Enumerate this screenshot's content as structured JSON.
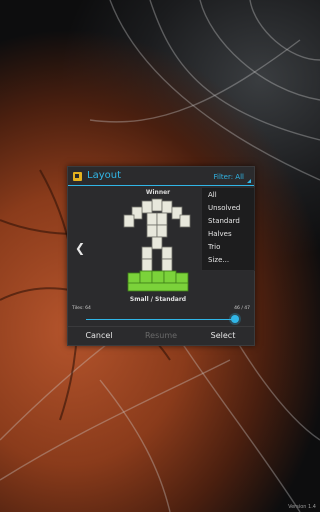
{
  "dialog": {
    "title": "Layout",
    "filter_label": "Filter: All"
  },
  "puzzle": {
    "name": "Winner",
    "size_label": "Small / Standard",
    "tiles_label": "Tiles: 64",
    "progress_label": "46 / 47",
    "progress_fraction": 0.979
  },
  "filter_options": [
    "All",
    "Unsolved",
    "Standard",
    "Halves",
    "Trio",
    "Size..."
  ],
  "buttons": {
    "cancel": "Cancel",
    "resume": "Resume",
    "select": "Select"
  },
  "version": "Version 1.4",
  "colors": {
    "accent": "#31b6e7",
    "tile": "#e8e8dc",
    "tile_green": "#7bd23a"
  }
}
